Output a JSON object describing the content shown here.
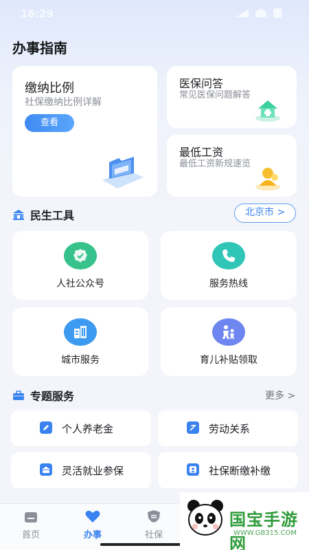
{
  "status_bar": {
    "time": "16:29"
  },
  "page_title": "办事指南",
  "top_cards": {
    "ratio": {
      "title": "缴纳比例",
      "subtitle": "社保缴纳比例详解",
      "button": "查看"
    },
    "medical": {
      "title": "医保问答",
      "subtitle": "常见医保问题解答"
    },
    "wage": {
      "title": "最低工资",
      "subtitle": "最低工资新规速览"
    }
  },
  "tools_section": {
    "title": "民生工具",
    "city_button": "北京市 >",
    "items": [
      {
        "label": "人社公众号",
        "icon": "check-badge-icon"
      },
      {
        "label": "服务热线",
        "icon": "phone-icon"
      },
      {
        "label": "城市服务",
        "icon": "building-icon"
      },
      {
        "label": "育儿补贴领取",
        "icon": "parent-child-icon"
      }
    ]
  },
  "topics_section": {
    "title": "专题服务",
    "more": "更多 >",
    "items": [
      {
        "label": "个人养老金",
        "icon": "pen-icon"
      },
      {
        "label": "劳动关系",
        "icon": "hammer-sickle-icon"
      },
      {
        "label": "灵活就业参保",
        "icon": "briefcase-icon"
      },
      {
        "label": "社保断缴补缴",
        "icon": "id-card-icon"
      }
    ]
  },
  "tab_bar": {
    "tabs": [
      {
        "label": "首页",
        "icon": "home-icon"
      },
      {
        "label": "办事",
        "icon": "heart-icon",
        "active": true
      },
      {
        "label": "社保",
        "icon": "shield-icon"
      }
    ]
  },
  "watermark": {
    "text": "国宝手游网",
    "url": "WWW.GB315.COM"
  },
  "colors": {
    "accent": "#3a82ef",
    "green": "#36c28a",
    "teal": "#2fc6b8",
    "badge_blue": "#3c9af0",
    "purple_blue": "#6f86f0"
  }
}
